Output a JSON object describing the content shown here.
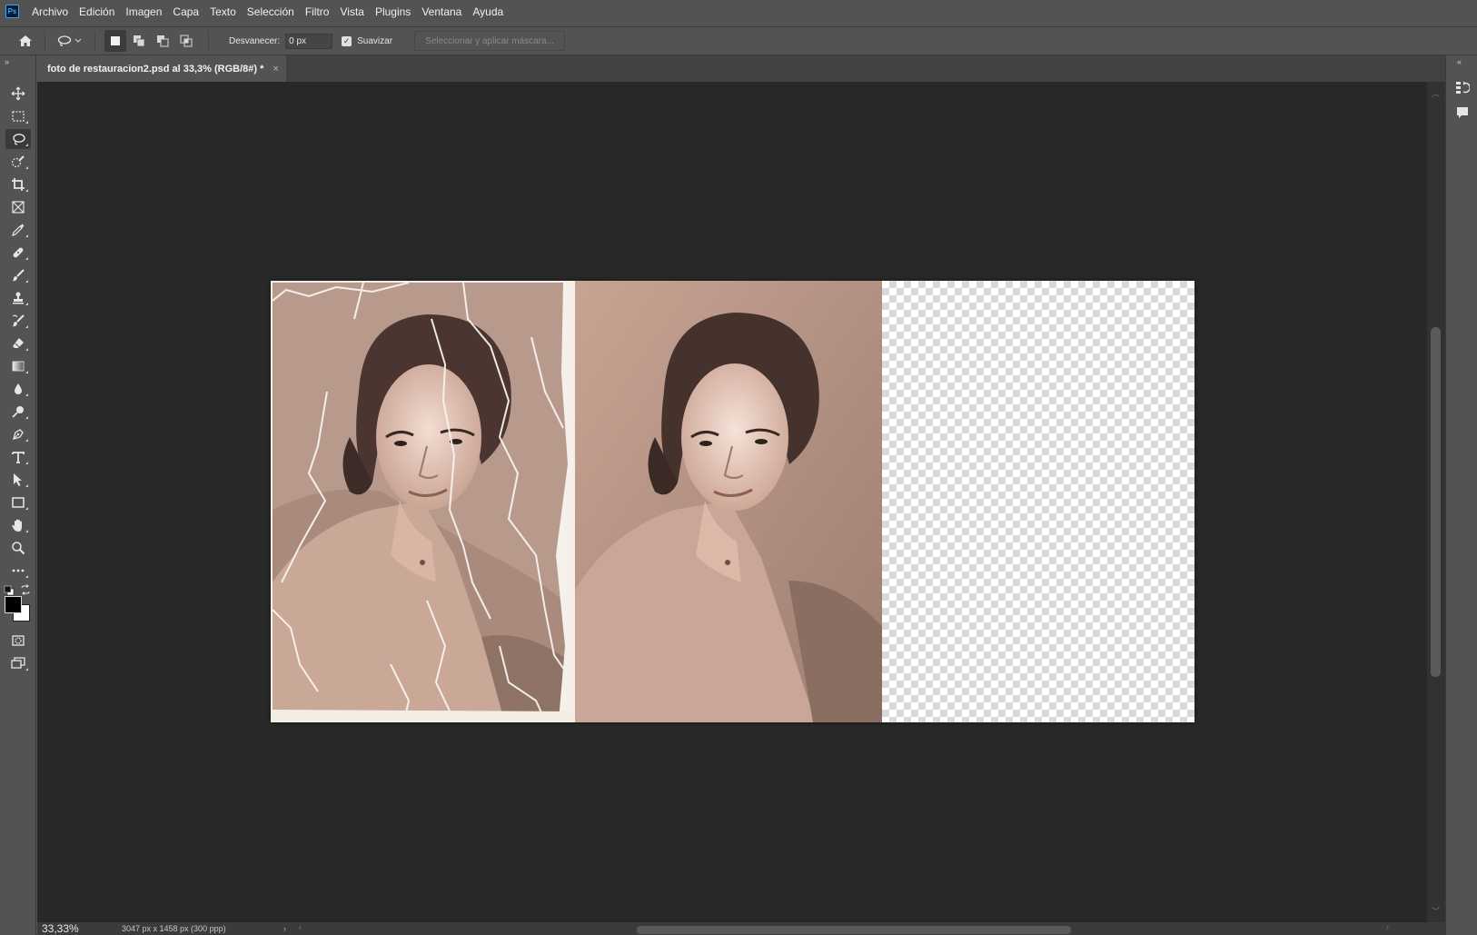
{
  "app": {
    "logo_text": "Ps"
  },
  "menu": [
    "Archivo",
    "Edición",
    "Imagen",
    "Capa",
    "Texto",
    "Selección",
    "Filtro",
    "Vista",
    "Plugins",
    "Ventana",
    "Ayuda"
  ],
  "options": {
    "feather_label": "Desvanecer:",
    "feather_value": "0 px",
    "antialias_label": "Suavizar",
    "antialias_checked": true,
    "select_mask_label": "Seleccionar y aplicar máscara..."
  },
  "toolbar": {
    "active_tool": "lasso-tool",
    "tools": [
      "move-tool",
      "rectangular-marquee-tool",
      "lasso-tool",
      "quick-selection-tool",
      "crop-tool",
      "frame-tool",
      "eyedropper-tool",
      "spot-healing-brush-tool",
      "brush-tool",
      "clone-stamp-tool",
      "history-brush-tool",
      "eraser-tool",
      "gradient-tool",
      "blur-tool",
      "dodge-tool",
      "pen-tool",
      "type-tool",
      "path-selection-tool",
      "rectangle-tool",
      "hand-tool",
      "zoom-tool",
      "edit-toolbar-tool"
    ],
    "foreground_color": "#000000",
    "background_color": "#ffffff"
  },
  "document": {
    "tab_title": "foto de restauracion2.psd al 33,3% (RGB/8#) *",
    "close_glyph": "×"
  },
  "status": {
    "zoom": "33,33%",
    "doc_info": "3047 px x 1458 px (300 ppp)"
  },
  "colors": {
    "ui_background": "#535353",
    "canvas_background": "#282828",
    "accent": "#31a8ff"
  }
}
